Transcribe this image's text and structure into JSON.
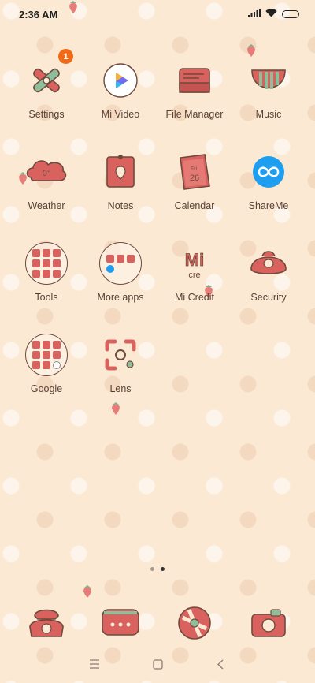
{
  "status": {
    "time": "2:36 AM"
  },
  "colors": {
    "wallpaper": "#fbe9d3",
    "icon_red": "#d9625f",
    "icon_outline": "#6e4a3d",
    "badge": "#f06a17",
    "label": "#5a4036"
  },
  "apps": [
    {
      "label": "Settings",
      "icon": "settings-icon",
      "badge": "1"
    },
    {
      "label": "Mi Video",
      "icon": "mi-video-icon"
    },
    {
      "label": "File Manager",
      "icon": "file-manager-icon"
    },
    {
      "label": "Music",
      "icon": "music-icon"
    },
    {
      "label": "Weather",
      "icon": "weather-icon",
      "icon_text": "0°"
    },
    {
      "label": "Notes",
      "icon": "notes-icon"
    },
    {
      "label": "Calendar",
      "icon": "calendar-icon",
      "icon_text": "Fri",
      "icon_text2": "26"
    },
    {
      "label": "ShareMe",
      "icon": "shareme-icon"
    },
    {
      "label": "Tools",
      "icon": "tools-folder-icon"
    },
    {
      "label": "More apps",
      "icon": "more-apps-folder-icon"
    },
    {
      "label": "Mi Credit",
      "icon": "mi-credit-icon",
      "icon_text": "Mi",
      "icon_text2": "cre"
    },
    {
      "label": "Security",
      "icon": "security-icon"
    },
    {
      "label": "Google",
      "icon": "google-folder-icon"
    },
    {
      "label": "Lens",
      "icon": "lens-icon"
    }
  ],
  "pager": {
    "pages": 2,
    "current": 2
  },
  "dock": [
    {
      "icon": "phone-icon"
    },
    {
      "icon": "messaging-icon"
    },
    {
      "icon": "browser-icon"
    },
    {
      "icon": "camera-icon"
    }
  ],
  "navigation": {
    "menu": "menu-icon",
    "home": "home-icon",
    "back": "back-icon"
  }
}
